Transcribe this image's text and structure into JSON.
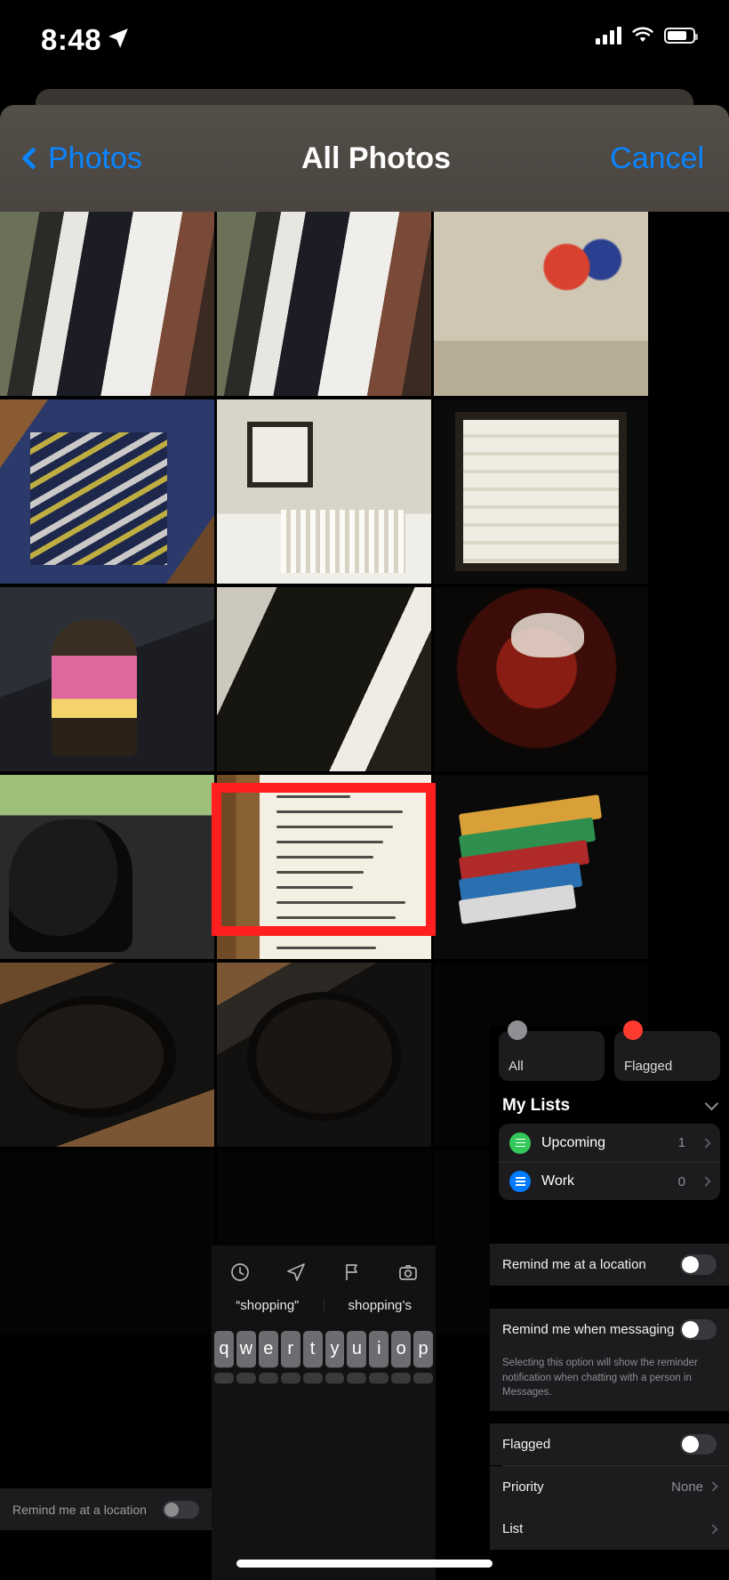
{
  "status_bar": {
    "time": "8:48",
    "location_icon": "location-arrow-icon",
    "cellular_icon": "cellular-signal-icon",
    "wifi_icon": "wifi-icon",
    "battery_icon": "battery-icon"
  },
  "sheet": {
    "back_label": "Photos",
    "title": "All Photos",
    "cancel_label": "Cancel",
    "back_icon": "chevron-left-icon"
  },
  "photo_grid": {
    "tiles": [
      {
        "id": "photo-doorway-1",
        "kind": "p-doorway"
      },
      {
        "id": "photo-doorway-2",
        "kind": "p-doorway"
      },
      {
        "id": "photo-south-philly-shirt",
        "kind": "p-shirt"
      },
      {
        "id": "photo-bird-rug",
        "kind": "p-rug"
      },
      {
        "id": "photo-nursery-crib",
        "kind": "p-nursery"
      },
      {
        "id": "photo-insect-poster",
        "kind": "p-bugs"
      },
      {
        "id": "photo-beer-bottle",
        "kind": "p-bottle"
      },
      {
        "id": "photo-dog-doorway",
        "kind": "p-dogdark"
      },
      {
        "id": "photo-lizard-model",
        "kind": "p-lizard"
      },
      {
        "id": "photo-dog-in-car",
        "kind": "p-carwindow"
      },
      {
        "id": "photo-handwritten-shopping-list",
        "kind": "p-notes"
      },
      {
        "id": "photo-book-stack",
        "kind": "p-books"
      },
      {
        "id": "photo-dog-on-bed-1",
        "kind": "p-dogbed1"
      },
      {
        "id": "photo-dog-on-bed-2",
        "kind": "p-dogbed2"
      },
      {
        "id": "photo-empty-1",
        "kind": "p-black"
      },
      {
        "id": "photo-empty-2",
        "kind": "p-black"
      },
      {
        "id": "photo-empty-3",
        "kind": "p-black"
      },
      {
        "id": "photo-empty-4",
        "kind": "p-black"
      }
    ],
    "selected_tile_id": "photo-handwritten-shopping-list",
    "selection_color": "#ff1f1f"
  },
  "reminders": {
    "smart_lists": [
      {
        "name": "All",
        "glyph_color": "#8e8e93"
      },
      {
        "name": "Flagged",
        "glyph_color": "#ff3b30"
      }
    ],
    "section_title": "My Lists",
    "collapse_icon": "chevron-down-icon",
    "lists": [
      {
        "name": "Upcoming",
        "count": "1",
        "color": "#34c759"
      },
      {
        "name": "Work",
        "count": "0",
        "color": "#007aff"
      }
    ]
  },
  "reminder_detail": {
    "rows": [
      {
        "label": "Remind me at a location",
        "type": "toggle",
        "value": "off"
      },
      {
        "label": "Remind me when messaging",
        "type": "toggle",
        "value": "off"
      },
      {
        "label": "Flagged",
        "type": "toggle",
        "value": "off"
      },
      {
        "label": "Priority",
        "type": "value",
        "value": "None"
      },
      {
        "label": "List",
        "type": "value",
        "value": ""
      }
    ],
    "messaging_note": "Selecting this option will show the reminder notification when chatting with a person in Messages.",
    "disclosure_icon": "chevron-right-icon"
  },
  "bottom_left": {
    "label": "Remind me at a location",
    "toggle_state": "off"
  },
  "keyboard": {
    "accessory_icons": [
      "clock-icon",
      "location-arrow-icon",
      "flag-icon",
      "camera-icon"
    ],
    "suggestions": [
      "“shopping”",
      "shopping’s"
    ],
    "row1": [
      "q",
      "w",
      "e",
      "r",
      "t",
      "y",
      "u",
      "i",
      "o",
      "p"
    ]
  },
  "home_indicator": "home-indicator"
}
